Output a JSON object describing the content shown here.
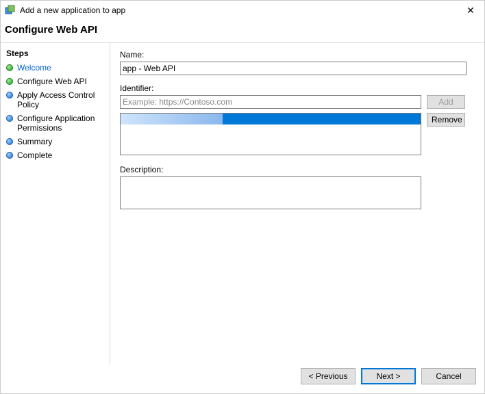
{
  "window": {
    "title": "Add a new application to app",
    "close_glyph": "✕"
  },
  "header": {
    "title": "Configure Web API"
  },
  "sidebar": {
    "title": "Steps",
    "items": [
      {
        "label": "Welcome",
        "state": "green",
        "link": true
      },
      {
        "label": "Configure Web API",
        "state": "green",
        "link": false
      },
      {
        "label": "Apply Access Control Policy",
        "state": "blue",
        "link": false
      },
      {
        "label": "Configure Application Permissions",
        "state": "blue",
        "link": false
      },
      {
        "label": "Summary",
        "state": "blue",
        "link": false
      },
      {
        "label": "Complete",
        "state": "blue",
        "link": false
      }
    ]
  },
  "form": {
    "name_label": "Name:",
    "name_value": "app - Web API",
    "identifier_label": "Identifier:",
    "identifier_placeholder": "Example: https://Contoso.com",
    "identifier_value": "",
    "add_button": "Add",
    "remove_button": "Remove",
    "description_label": "Description:",
    "description_value": ""
  },
  "footer": {
    "previous": "< Previous",
    "next": "Next >",
    "cancel": "Cancel"
  }
}
